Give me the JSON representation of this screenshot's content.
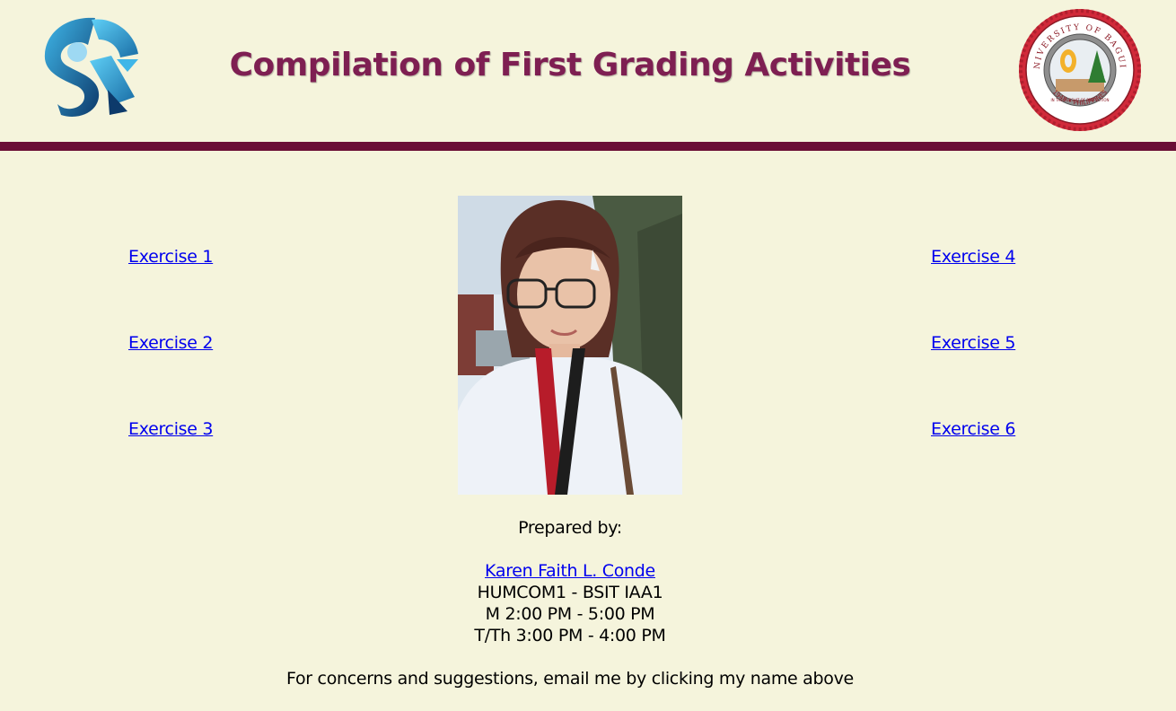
{
  "header": {
    "title": "Compilation of First Grading Activities",
    "left_logo_icon": "si-logo-icon",
    "right_logo_icon": "university-of-baguio-seal-icon",
    "seal_text": "UNIVERSITY OF BAGUIO",
    "seal_year": "1948 • PHILIPPINES",
    "seal_motto": "IN THE PURSUIT OF PERFECTION"
  },
  "links": {
    "left": [
      "Exercise 1",
      "Exercise 2",
      "Exercise 3"
    ],
    "right": [
      "Exercise 4",
      "Exercise 5",
      "Exercise 6"
    ]
  },
  "footer": {
    "prepared_by_label": "Prepared by:",
    "name": "Karen Faith L. Conde",
    "course": "HUMCOM1 - BSIT IAA1",
    "schedule_1": "M 2:00 PM - 5:00 PM",
    "schedule_2": "T/Th 3:00 PM - 4:00 PM",
    "note": "For concerns and suggestions, email me by clicking my name above"
  },
  "colors": {
    "background": "#f5f4dc",
    "title": "#7e1f52",
    "rule": "#6b0f36",
    "link": "#0000ee"
  }
}
